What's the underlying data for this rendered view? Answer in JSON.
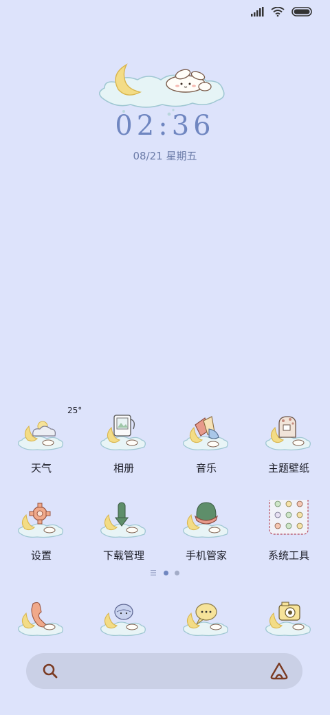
{
  "status_bar": {
    "icons": [
      "signal-icon",
      "wifi-icon",
      "battery-icon"
    ]
  },
  "clock": {
    "time": "02:36",
    "date": "08/21 星期五"
  },
  "apps_row1": [
    {
      "label": "天气",
      "icon": "weather-icon",
      "badge": "25°"
    },
    {
      "label": "相册",
      "icon": "gallery-icon"
    },
    {
      "label": "音乐",
      "icon": "music-icon"
    },
    {
      "label": "主题壁纸",
      "icon": "themes-icon"
    }
  ],
  "apps_row2": [
    {
      "label": "设置",
      "icon": "settings-icon"
    },
    {
      "label": "下载管理",
      "icon": "download-icon"
    },
    {
      "label": "手机管家",
      "icon": "security-icon"
    },
    {
      "label": "系统工具",
      "icon": "tools-folder-icon"
    }
  ],
  "page_indicator": {
    "pages": 2,
    "current": 1
  },
  "dock": [
    {
      "icon": "phone-icon"
    },
    {
      "icon": "contacts-icon"
    },
    {
      "icon": "messages-icon"
    },
    {
      "icon": "camera-icon"
    }
  ],
  "search_bar": {
    "left_icon": "search-icon",
    "right_icon": "assistant-icon"
  },
  "colors": {
    "background": "#dde3fb",
    "clock": "#6f86c0",
    "search_bar": "#cad0e6",
    "accent": "#7a3a22"
  }
}
